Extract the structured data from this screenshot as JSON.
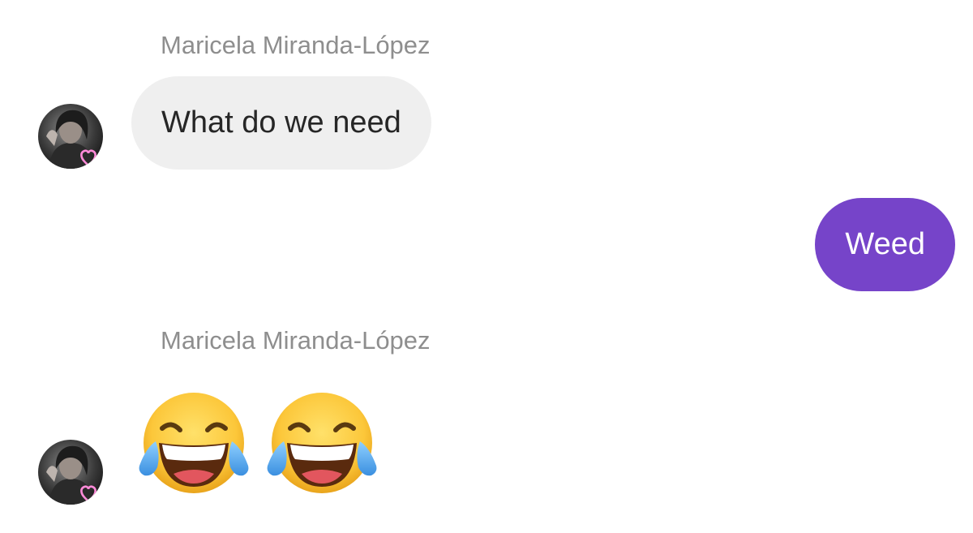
{
  "messages": [
    {
      "sender": "Maricela Miranda-López",
      "text": "What do we need",
      "direction": "incoming",
      "avatar_icon": "profile-photo-with-heart"
    },
    {
      "text": "Weed",
      "direction": "outgoing"
    },
    {
      "sender": "Maricela Miranda-López",
      "emoji": [
        "face-with-tears-of-joy-icon",
        "face-with-tears-of-joy-icon"
      ],
      "direction": "incoming",
      "avatar_icon": "profile-photo-with-heart"
    }
  ],
  "colors": {
    "incoming_bubble": "#efefef",
    "outgoing_bubble": "#7644c9",
    "sender_name": "#8e8e8e",
    "incoming_text": "#262626",
    "outgoing_text": "#ffffff"
  }
}
